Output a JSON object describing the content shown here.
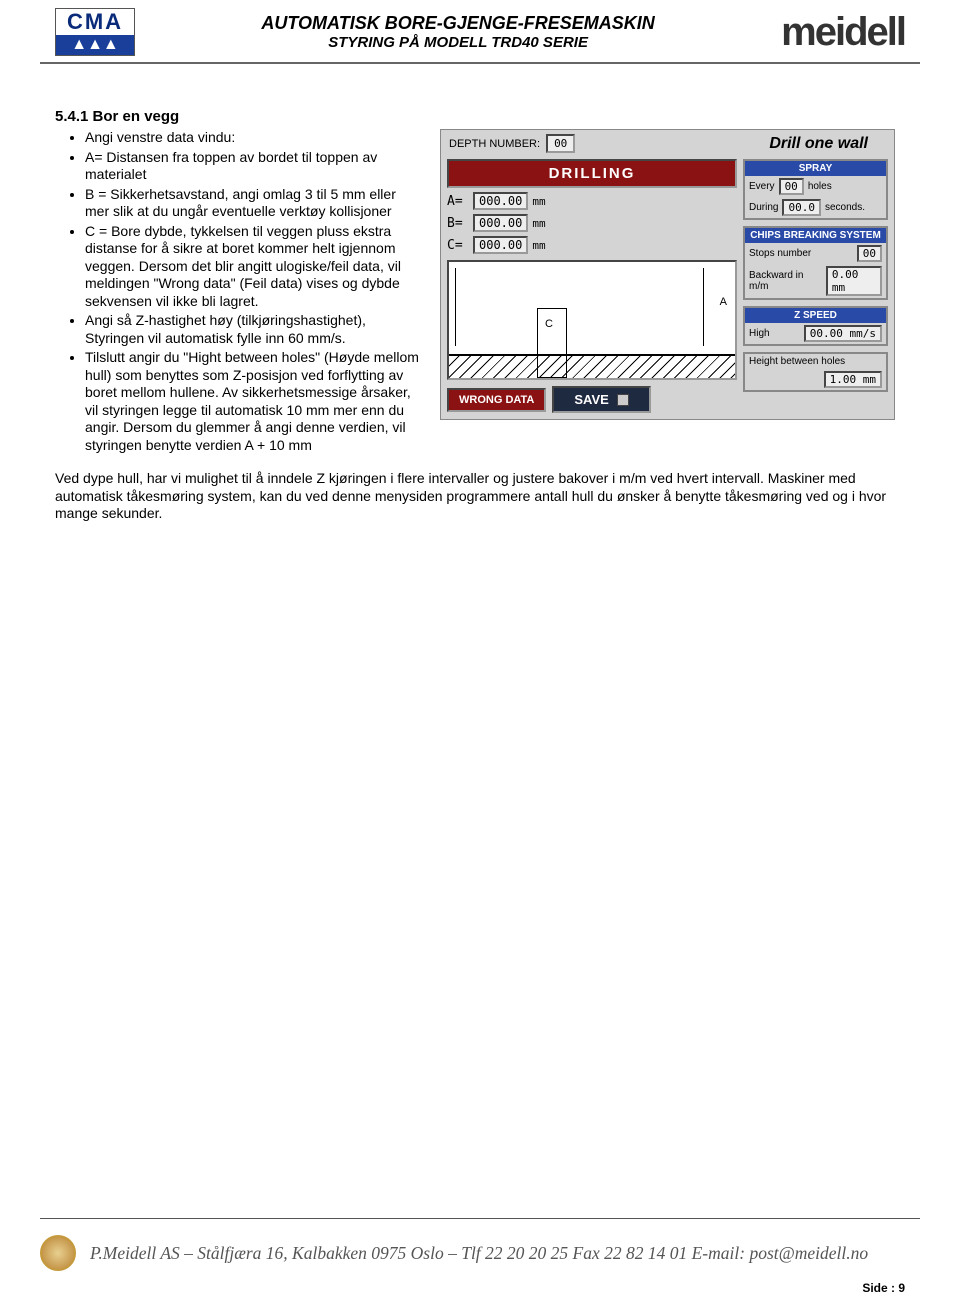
{
  "header": {
    "title1": "AUTOMATISK BORE-GJENGE-FRESEMASKIN",
    "title2": "STYRING PÅ MODELL TRD40 SERIE",
    "logo_cma": "CMA",
    "logo_cma_tri": "▲▲▲",
    "logo_meidell": "meidell"
  },
  "section": {
    "heading": "5.4.1 Bor en vegg",
    "bullets": [
      "Angi venstre data vindu:",
      "A= Distansen fra toppen av bordet til toppen av materialet",
      "B = Sikkerhetsavstand, angi omlag 3 til 5 mm eller mer slik at du ungår eventuelle verktøy kollisjoner",
      "C = Bore dybde, tykkelsen til veggen pluss ekstra distanse for å sikre at boret kommer helt igjennom veggen. Dersom det blir angitt ulogiske/feil data, vil meldingen \"Wrong data\" (Feil data) vises og dybde sekvensen vil ikke bli lagret.",
      "Angi så Z-hastighet høy (tilkjøringshastighet), Styringen vil automatisk fylle inn 60 mm/s.",
      "Tilslutt angir du \"Hight between holes\" (Høyde mellom hull) som benyttes som Z-posisjon ved forflytting av boret mellom hullene. Av sikkerhetsmessige årsaker, vil styringen legge til automatisk 10 mm mer enn du angir. Dersom du glemmer å angi denne verdien, vil styringen benytte verdien A + 10 mm"
    ],
    "below": "Ved dype hull, har vi mulighet til å inndele Z kjøringen i flere intervaller og justere bakover i m/m ved hvert intervall. Maskiner med automatisk tåkesmøring system, kan du ved denne menysiden programmere antall hull du ønsker å benytte tåkesmøring ved og i hvor mange sekunder."
  },
  "ui": {
    "depth_label": "DEPTH NUMBER:",
    "depth_val": "00",
    "drill_title": "Drill one wall",
    "drilling": "DRILLING",
    "a_label": "A=",
    "a_val": "000.00",
    "a_unit": "mm",
    "b_label": "B=",
    "b_val": "000.00",
    "b_unit": "mm",
    "c_label": "C=",
    "c_val": "000.00",
    "c_unit": "mm",
    "diag_c": "C",
    "diag_a": "A",
    "wrong": "WRONG DATA",
    "save": "SAVE",
    "spray_hd": "SPRAY",
    "spray_every": "Every",
    "spray_every_val": "00",
    "spray_holes": "holes",
    "spray_during": "During",
    "spray_during_val": "00.0",
    "spray_seconds": "seconds.",
    "chips_hd": "CHIPS BREAKING SYSTEM",
    "stops_label": "Stops number",
    "stops_val": "00",
    "back_label": "Backward in m/m",
    "back_val": "0.00 mm",
    "zspeed_hd": "Z SPEED",
    "zspeed_label": "High",
    "zspeed_val": "00.00 mm/s",
    "height_label": "Height between holes",
    "height_val": "1.00 mm"
  },
  "footer": {
    "text": "P.Meidell AS – Stålfjæra 16, Kalbakken 0975 Oslo – Tlf 22 20 20 25  Fax 22 82 14 01  E-mail: post@meidell.no",
    "page": "Side : 9"
  }
}
